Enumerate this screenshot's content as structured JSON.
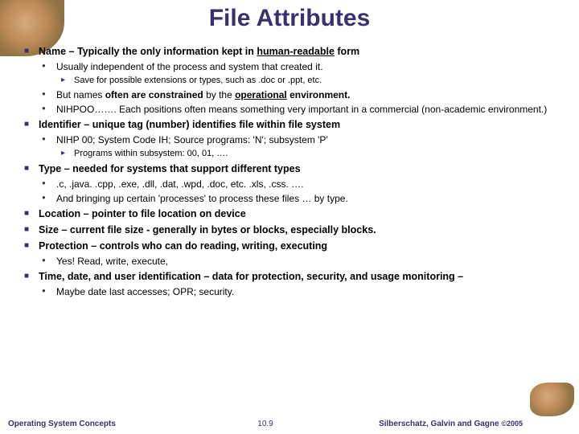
{
  "title": "File Attributes",
  "items": [
    {
      "prefix": "Name",
      "rest": " – Typically the only information kept in ",
      "uword": "human-readable",
      "tail": " form",
      "sub": [
        {
          "text": "Usually independent of the process and system that created it.",
          "sub": [
            {
              "text": "Save for possible extensions or types, such as .doc or .ppt, etc."
            }
          ]
        },
        {
          "html": "But names <span class='b'>often are constrained</span> by the <span class='b u'>operational</span> <span class='b'>environment.</span>"
        },
        {
          "text": "NIHPOO……. Each positions often means something very important in a commercial (non-academic environment.)"
        }
      ]
    },
    {
      "prefix": "Identifier",
      "rest": " – unique tag (number) identifies file within file system",
      "sub": [
        {
          "text": "NIHP 00;  System Code IH;  Source programs:  'N';  subsystem 'P'",
          "sub": [
            {
              "text": "Programs within subsystem:  00, 01, …."
            }
          ]
        }
      ]
    },
    {
      "prefix": "Type",
      "rest": " – needed for systems that support different types",
      "sub": [
        {
          "text": ".c,  .java.  .cpp,  .exe,  .dll,  .dat,  .wpd,  .doc,  etc.  .xls,  .css. …."
        },
        {
          "text": "And bringing up certain 'processes' to process these files … by type."
        }
      ]
    },
    {
      "prefix": "Location",
      "rest": " – pointer to file location on device"
    },
    {
      "prefix": "Size",
      "rest": " – current file size  -  generally in bytes or blocks, especially blocks."
    },
    {
      "prefix": "Protection",
      "rest": " – controls who can do reading, writing, executing",
      "sub": [
        {
          "text": "Yes!  Read, write, execute,"
        }
      ]
    },
    {
      "prefix": "Time, date, and user identification",
      "rest": " – data for protection, security, and usage monitoring –",
      "sub": [
        {
          "text": "Maybe date last accesses;  OPR; security."
        }
      ]
    }
  ],
  "footer": {
    "left": "Operating System Concepts",
    "center": "10.9",
    "right": "Silberschatz, Galvin and Gagne ",
    "copy": "©2005"
  }
}
